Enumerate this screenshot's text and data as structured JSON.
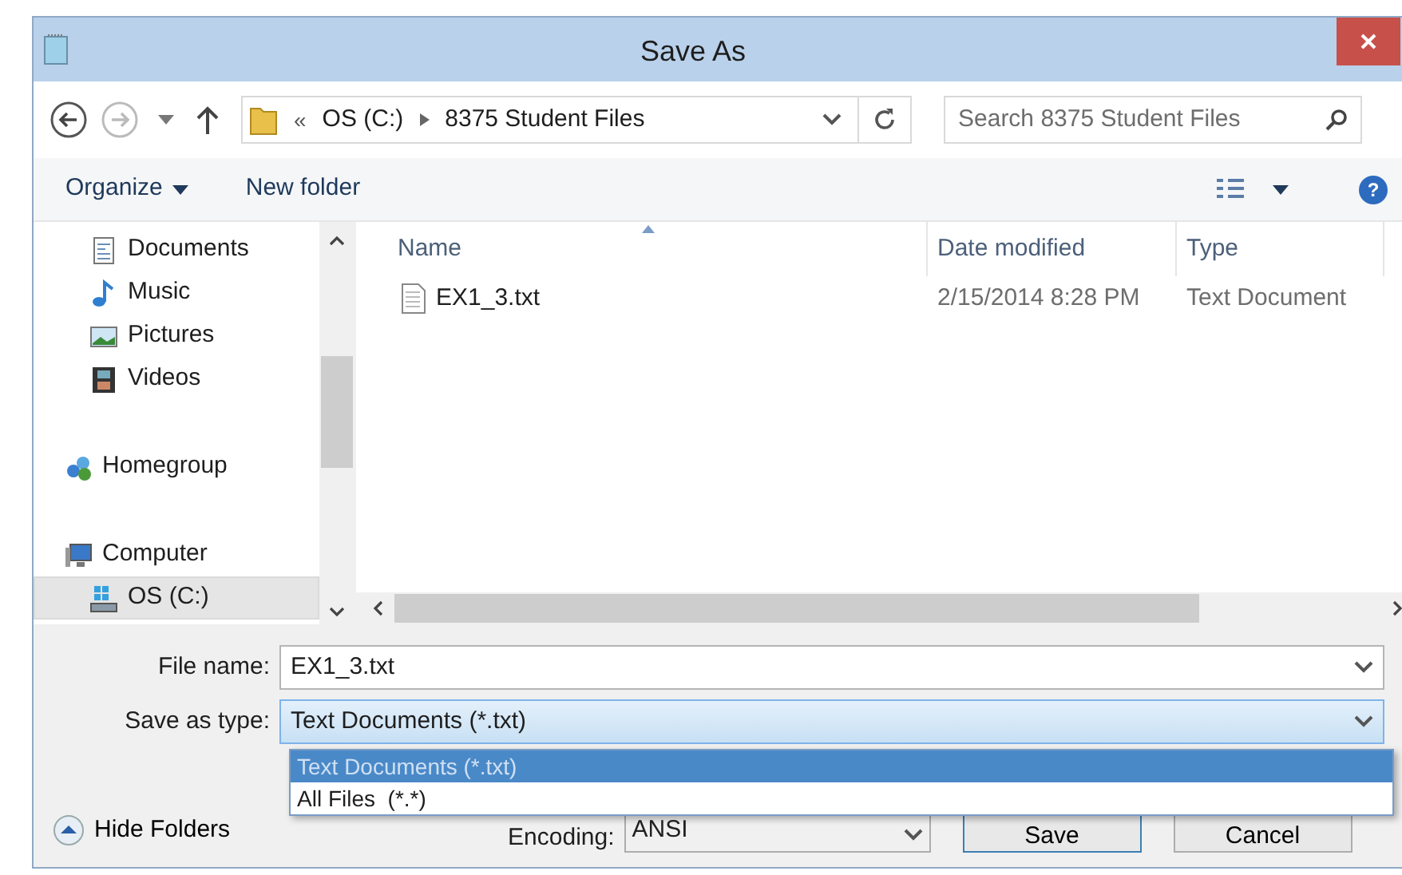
{
  "window": {
    "title": "Save As"
  },
  "address_bar": {
    "overflow": "«",
    "breadcrumbs": [
      "OS (C:)",
      "8375 Student Files"
    ]
  },
  "search": {
    "placeholder": "Search 8375 Student Files"
  },
  "toolbar": {
    "organize": "Organize",
    "new_folder": "New folder",
    "help": "?"
  },
  "nav_pane": {
    "library_items": [
      {
        "label": "Documents",
        "kind": "documents",
        "selected": false
      },
      {
        "label": "Music",
        "kind": "music",
        "selected": false
      },
      {
        "label": "Pictures",
        "kind": "pictures",
        "selected": false
      },
      {
        "label": "Videos",
        "kind": "videos",
        "selected": false
      }
    ],
    "items": [
      {
        "label": "Homegroup",
        "kind": "homegroup",
        "selected": false
      },
      {
        "label": "Computer",
        "kind": "computer",
        "selected": false,
        "children": [
          {
            "label": "OS (C:)",
            "kind": "drive",
            "selected": true
          }
        ]
      }
    ]
  },
  "file_list": {
    "columns": [
      {
        "label": "Name",
        "sorted": true
      },
      {
        "label": "Date modified",
        "sorted": false
      },
      {
        "label": "Type",
        "sorted": false
      }
    ],
    "rows": [
      {
        "cells": [
          "EX1_3.txt",
          "2/15/2014 8:28 PM",
          "Text Document"
        ],
        "selected": false
      }
    ]
  },
  "file_name": {
    "label": "File name:",
    "value": "EX1_3.txt"
  },
  "save_as_type": {
    "label": "Save as type:",
    "value": "Text Documents (*.txt)",
    "expanded": true,
    "options": [
      {
        "label": "Text Documents (*.txt)",
        "selected": true
      },
      {
        "label": "All Files  (*.*)",
        "selected": false
      }
    ]
  },
  "hide_folders": "Hide Folders",
  "encoding": {
    "label": "Encoding:",
    "value": "ANSI"
  },
  "buttons": [
    {
      "label": "Save",
      "default": true
    },
    {
      "label": "Cancel",
      "default": false
    }
  ]
}
